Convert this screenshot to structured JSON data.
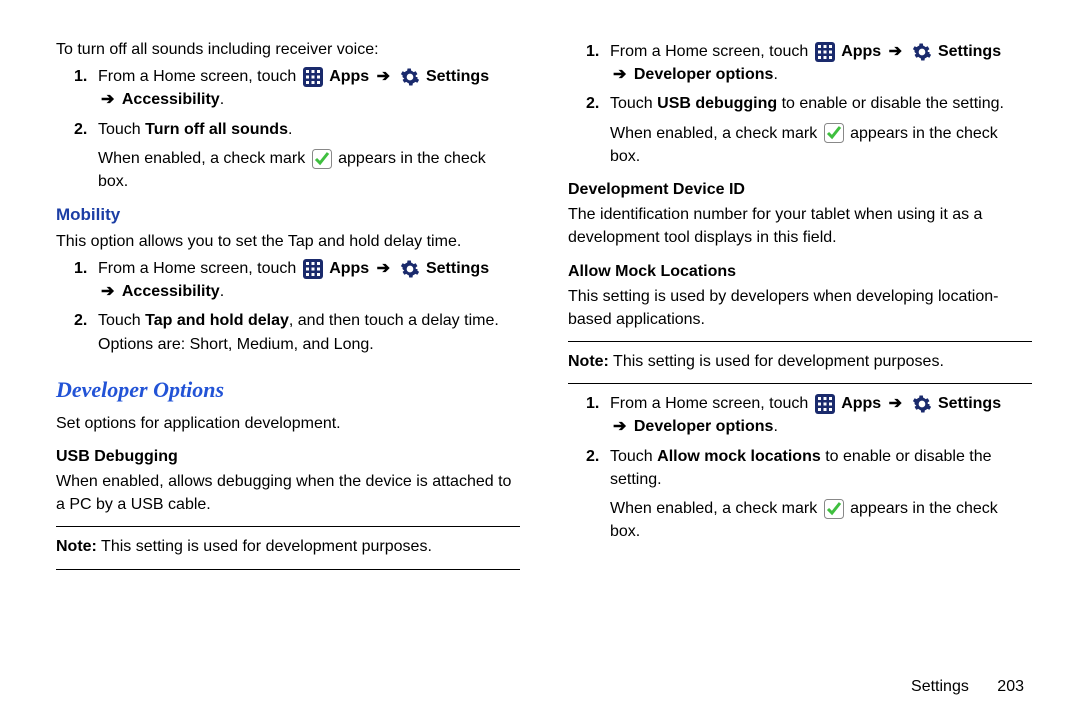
{
  "left": {
    "intro": "To turn off all sounds including receiver voice:",
    "s1_a": "From a Home screen, touch",
    "apps": "Apps",
    "settings": "Settings",
    "accessibility": "Accessibility",
    "s2_a": "Touch",
    "turn_off_all_sounds": "Turn off all sounds",
    "period": ".",
    "check_pre": "When enabled, a check mark",
    "check_post": "appears in the check box.",
    "mobility_h": "Mobility",
    "mobility_p": "This option allows you to set the Tap and hold delay time.",
    "s2_b_pre": "Touch",
    "tap_hold": "Tap and hold delay",
    "s2_b_post": ", and then touch a delay time. Options are: Short, Medium, and Long.",
    "dev_h": "Developer Options",
    "dev_p": "Set options for application development.",
    "usb_h": "USB Debugging",
    "usb_p": "When enabled, allows debugging when the device is attached to a PC by a USB cable.",
    "note_pre": "Note:",
    "note_text": "This setting is used for development purposes."
  },
  "right": {
    "s1_a": "From a Home screen, touch",
    "apps": "Apps",
    "settings": "Settings",
    "developer_options": "Developer options",
    "s2_a_pre": "Touch",
    "usb_debug": "USB debugging",
    "s2_a_post": "to enable or disable the setting.",
    "check_pre": "When enabled, a check mark",
    "check_post": "appears in the check box.",
    "devid_h": "Development Device ID",
    "devid_p": "The identification number for your tablet when using it as a development tool displays in this field.",
    "allow_h": "Allow Mock Locations",
    "allow_p": "This setting is used by developers when developing location-based applications.",
    "note_pre": "Note:",
    "note_text": "This setting is used for development purposes.",
    "s2_b_pre": "Touch",
    "allow_mock": "Allow mock locations",
    "s2_b_post": "to enable or disable the setting."
  },
  "footer": {
    "label": "Settings",
    "page": "203"
  },
  "step_labels": {
    "one": "1.",
    "two": "2."
  },
  "arrow": "➔"
}
